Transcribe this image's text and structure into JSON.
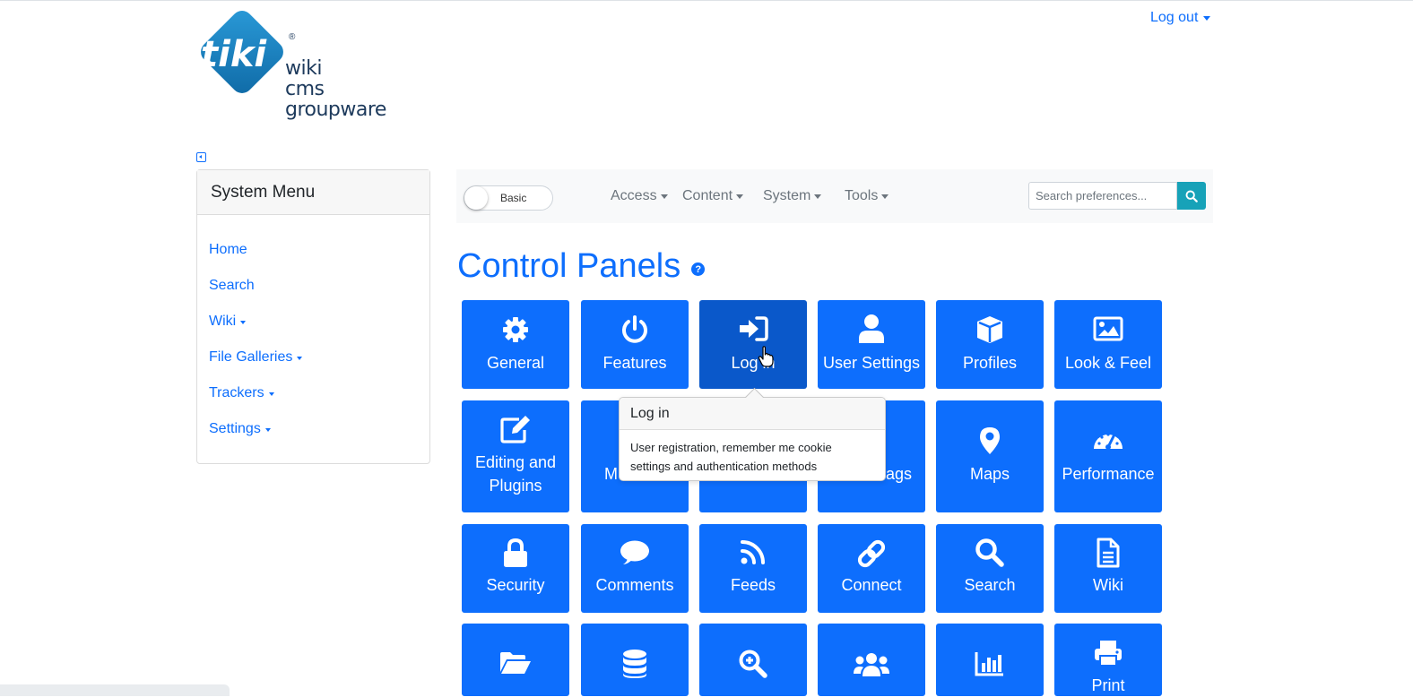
{
  "header": {
    "logo_lines": [
      "wiki",
      "cms",
      "groupware"
    ],
    "logo_word": "tiki",
    "logo_registered": "®",
    "logout_label": "Log out"
  },
  "sidebar": {
    "title": "System Menu",
    "items": [
      {
        "label": "Home",
        "has_caret": false
      },
      {
        "label": "Search",
        "has_caret": false
      },
      {
        "label": "Wiki",
        "has_caret": true
      },
      {
        "label": "File Galleries",
        "has_caret": true
      },
      {
        "label": "Trackers",
        "has_caret": true
      },
      {
        "label": "Settings",
        "has_caret": true
      }
    ]
  },
  "navbar": {
    "mode_toggle_label": "Basic",
    "menus": [
      "Access",
      "Content",
      "System",
      "Tools"
    ],
    "search_placeholder": "Search preferences..."
  },
  "main": {
    "title": "Control Panels",
    "help_glyph": "?",
    "tiles_row1": [
      {
        "label": "General",
        "icon": "gear-icon"
      },
      {
        "label": "Features",
        "icon": "power-icon"
      },
      {
        "label": "Log in",
        "icon": "sign-in-icon"
      },
      {
        "label": "User Settings",
        "icon": "user-icon"
      },
      {
        "label": "Profiles",
        "icon": "cube-icon"
      },
      {
        "label": "Look & Feel",
        "icon": "image-icon"
      }
    ],
    "tiles_row2": [
      {
        "label_lines": [
          "Editing and",
          "Plugins"
        ],
        "icon": "edit-icon"
      },
      {
        "label_lines": [
          "M"
        ],
        "icon": "hidden"
      },
      {
        "label_lines": [
          ""
        ],
        "icon": "hidden"
      },
      {
        "label_lines": [
          "ags"
        ],
        "icon": "hidden"
      },
      {
        "label_lines": [
          "Maps"
        ],
        "icon": "map-marker-icon"
      },
      {
        "label_lines": [
          "Performance"
        ],
        "icon": "tachometer-icon"
      }
    ],
    "tiles_row3": [
      {
        "label": "Security",
        "icon": "lock-icon"
      },
      {
        "label": "Comments",
        "icon": "comment-icon"
      },
      {
        "label": "Feeds",
        "icon": "rss-icon"
      },
      {
        "label": "Connect",
        "icon": "link-icon"
      },
      {
        "label": "Search",
        "icon": "search-icon"
      },
      {
        "label": "Wiki",
        "icon": "file-text-icon"
      }
    ],
    "tiles_row4": [
      {
        "label": "",
        "icon": "folder-open-icon"
      },
      {
        "label": "",
        "icon": "database-icon"
      },
      {
        "label": "",
        "icon": "search-plus-icon"
      },
      {
        "label": "",
        "icon": "users-icon"
      },
      {
        "label": "",
        "icon": "bar-chart-icon"
      },
      {
        "label": "Print",
        "icon": "print-icon"
      }
    ],
    "active_tile": "Log in"
  },
  "popover": {
    "title": "Log in",
    "body_lines": [
      "User registration, remember me cookie",
      "settings and authentication methods"
    ]
  },
  "colors": {
    "primary": "#0d6efd",
    "tile_active": "#0a58ca",
    "search_button": "#17a2b8",
    "logo_blue": "#1a8bd0"
  }
}
